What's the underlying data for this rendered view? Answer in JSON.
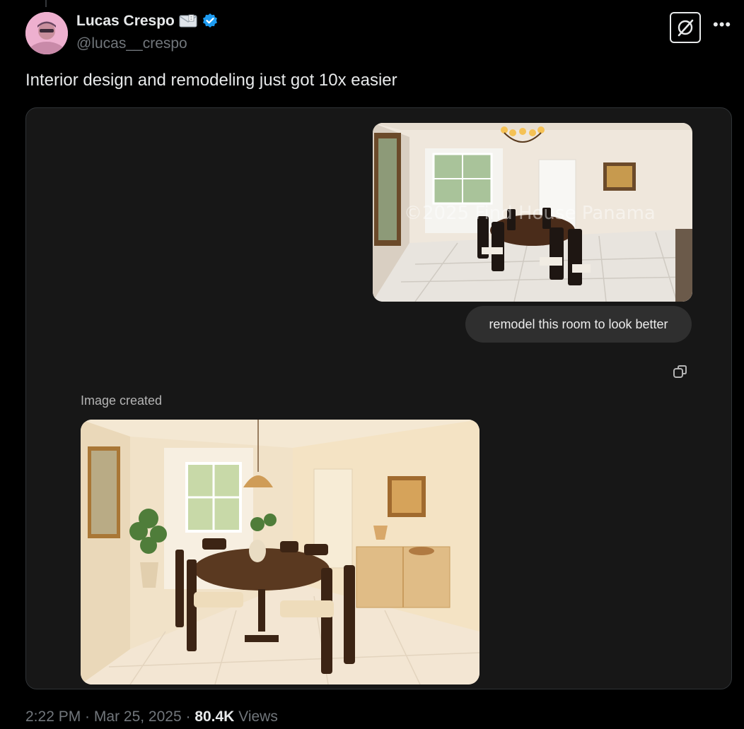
{
  "tweet": {
    "author": {
      "display_name": "Lucas Crespo",
      "handle": "@lucas__crespo",
      "avatar_icon": "avatar-photo",
      "badge_icons": [
        "envelope-icon",
        "verified-badge-icon"
      ]
    },
    "text": "Interior design and remodeling just got 10x easier",
    "timestamp": {
      "time": "2:22 PM",
      "sep1": " · ",
      "date": "Mar 25, 2025",
      "sep2": " · ",
      "views_count": "80.4K",
      "views_label": " Views"
    }
  },
  "chat_card": {
    "original_image_watermark": "©2025 Find House Panama",
    "prompt": "remodel this room to look better",
    "generated_label": "Image created",
    "copy_icon": "copy-icon"
  },
  "colors": {
    "background": "#000000",
    "card": "#171717",
    "bubble": "#2f2f2f",
    "verified_blue": "#1d9bf0",
    "muted_text": "#71767b"
  }
}
